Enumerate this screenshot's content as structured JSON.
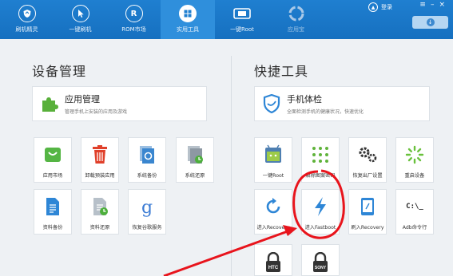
{
  "nav": {
    "items": [
      {
        "label": "刷机精灵",
        "icon": "shield-icon"
      },
      {
        "label": "一键刷机",
        "icon": "cursor-icon"
      },
      {
        "label": "ROM市场",
        "icon": "rom-icon"
      },
      {
        "label": "实用工具",
        "icon": "grid-icon"
      },
      {
        "label": "一键Root",
        "icon": "phone-icon"
      },
      {
        "label": "应用宝",
        "icon": "appbao-icon"
      }
    ],
    "active": "实用工具"
  },
  "header": {
    "login_label": "登录"
  },
  "device_mgmt": {
    "title": "设备管理",
    "card": {
      "title": "应用管理",
      "subtitle": "管理手机上安装的应用及游戏"
    },
    "tiles": [
      {
        "label": "应用市场",
        "icon": "app-market-icon"
      },
      {
        "label": "卸载预装应用",
        "icon": "trash-icon"
      },
      {
        "label": "系统备份",
        "icon": "system-backup-icon"
      },
      {
        "label": "系统还原",
        "icon": "system-restore-icon"
      },
      {
        "label": "资料备份",
        "icon": "doc-backup-icon"
      },
      {
        "label": "资料还原",
        "icon": "doc-restore-icon"
      },
      {
        "label": "恢复谷歌服务",
        "icon": "google-icon"
      }
    ]
  },
  "quick_tools": {
    "title": "快捷工具",
    "card": {
      "title": "手机体检",
      "subtitle": "全面检测手机的健康状况，快速优化"
    },
    "tiles": [
      {
        "label": "一键Root",
        "icon": "android-root-icon"
      },
      {
        "label": "解除图案密码",
        "icon": "pattern-icon"
      },
      {
        "label": "恢复出厂设置",
        "icon": "gears-icon"
      },
      {
        "label": "重启设备",
        "icon": "restart-icon"
      },
      {
        "label": "进入Recovery",
        "icon": "refresh-icon"
      },
      {
        "label": "进入Fastboot",
        "icon": "bolt-icon"
      },
      {
        "label": "刷入Recovery",
        "icon": "tablet-icon"
      },
      {
        "label": "Adb命令行",
        "icon": "terminal-icon"
      },
      {
        "label": "",
        "icon": "htc-lock-icon",
        "brand": "HTC"
      },
      {
        "label": "",
        "icon": "sony-lock-icon",
        "brand": "SONY"
      }
    ],
    "terminal_text": "C:\\_"
  },
  "annotations": {
    "circle_color": "#e8141c",
    "arrow_color": "#e8141c"
  },
  "colors": {
    "topbar": "#1670c0",
    "accent_blue": "#2e86d6",
    "green": "#5fb33a",
    "red": "#e0402a"
  }
}
